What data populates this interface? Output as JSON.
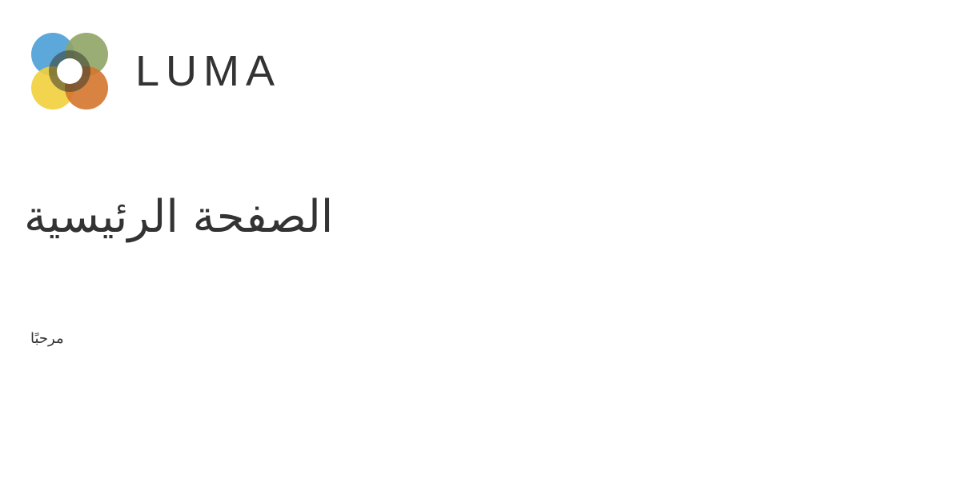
{
  "brand": {
    "name": "LUMA",
    "colors": {
      "blue": "#4a9fd6",
      "green": "#8fa465",
      "yellow": "#f2cf3c",
      "orange": "#d4762e",
      "text": "#333333"
    }
  },
  "main": {
    "title": "الصفحة الرئيسية",
    "greeting": "مرحبًا"
  }
}
